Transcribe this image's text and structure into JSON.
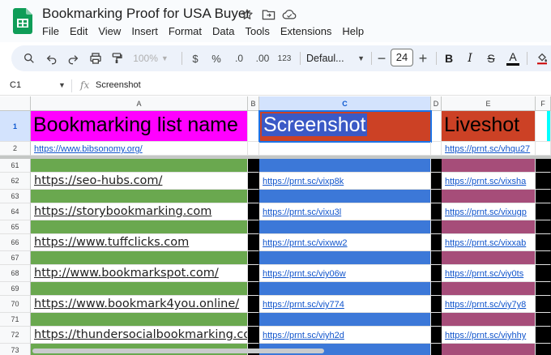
{
  "app": {
    "doc_title": "Bookmarking Proof for USA Buyer",
    "menu": [
      "File",
      "Edit",
      "View",
      "Insert",
      "Format",
      "Data",
      "Tools",
      "Extensions",
      "Help"
    ]
  },
  "toolbar": {
    "zoom": "100%",
    "currency": "$",
    "percent": "%",
    "dec_decrease": ".0",
    "dec_increase": ".00",
    "number_format": "123",
    "font": "Defaul...",
    "font_size": "24",
    "bold": "B",
    "italic": "I",
    "strike": "S",
    "text_color": "A"
  },
  "formula_bar": {
    "name_box": "C1",
    "fx": "fx",
    "content": "Screenshot"
  },
  "columns": [
    "A",
    "B",
    "C",
    "D",
    "E",
    "F"
  ],
  "header_row": {
    "row_number": "1",
    "a": "Bookmarking list name",
    "c": "Screenshot",
    "e": "Liveshot"
  },
  "row2": {
    "row_number": "2",
    "a": "https://www.bibsonomy.org/",
    "e": "https://prnt.sc/vhqu27"
  },
  "rows": [
    {
      "n": "61",
      "a": "",
      "c": "",
      "e": ""
    },
    {
      "n": "62",
      "a": "https://seo-hubs.com/",
      "c": "https://prnt.sc/vixp8k",
      "e": "https://prnt.sc/vixsha"
    },
    {
      "n": "63",
      "a": "",
      "c": "",
      "e": ""
    },
    {
      "n": "64",
      "a": "https://storybookmarking.com",
      "c": "https://prnt.sc/vixu3l",
      "e": "https://prnt.sc/vixugp"
    },
    {
      "n": "65",
      "a": "",
      "c": "",
      "e": ""
    },
    {
      "n": "66",
      "a": "https://www.tuffclicks.com",
      "c": "https://prnt.sc/vixww2",
      "e": "https://prnt.sc/vixxab"
    },
    {
      "n": "67",
      "a": "",
      "c": "",
      "e": ""
    },
    {
      "n": "68",
      "a": "http://www.bookmarkspot.com/",
      "c": "https://prnt.sc/viy06w",
      "e": "https://prnt.sc/viy0ts"
    },
    {
      "n": "69",
      "a": "",
      "c": "",
      "e": ""
    },
    {
      "n": "70",
      "a": "https://www.bookmark4you.online/",
      "c": "https://prnt.sc/viy774",
      "e": "https://prnt.sc/viy7y8"
    },
    {
      "n": "71",
      "a": "",
      "c": "",
      "e": ""
    },
    {
      "n": "72",
      "a": "https://thundersocialbookmarking.com",
      "c": "https://prnt.sc/viyh2d",
      "e": "https://prnt.sc/viyhhy"
    },
    {
      "n": "73",
      "a": "",
      "c": "",
      "e": ""
    }
  ],
  "colors": {
    "header_a_bg": "#ff00ff",
    "header_c_bg": "#cc4125",
    "header_e_bg": "#cc4125",
    "accent_cyan": "#00ffff",
    "green_fill": "#6aa84f",
    "blue_fill": "#3c78d8",
    "mauve_fill": "#a64d79",
    "black_fill": "#000000",
    "selection": "#1a73e8"
  }
}
